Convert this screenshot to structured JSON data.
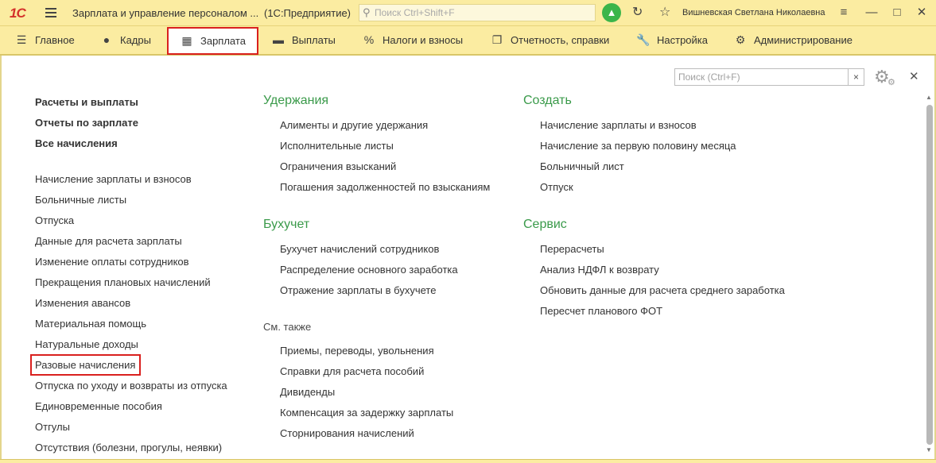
{
  "titlebar": {
    "logo": "1С",
    "app_title": "Зарплата и управление персоналом ...",
    "app_mode": "(1С:Предприятие)",
    "search_placeholder": "Поиск Ctrl+Shift+F",
    "user_name": "Вишневская Светлана Николаевна"
  },
  "sections": [
    {
      "label": "Главное",
      "icon": "menu-icon"
    },
    {
      "label": "Кадры",
      "icon": "people-icon"
    },
    {
      "label": "Зарплата",
      "icon": "calculator-icon",
      "active": true
    },
    {
      "label": "Выплаты",
      "icon": "wallet-icon"
    },
    {
      "label": "Налоги и взносы",
      "icon": "percent-icon"
    },
    {
      "label": "Отчетность, справки",
      "icon": "documents-icon"
    },
    {
      "label": "Настройка",
      "icon": "wrench-icon"
    },
    {
      "label": "Администрирование",
      "icon": "gear-icon"
    }
  ],
  "content": {
    "search_placeholder": "Поиск (Ctrl+F)",
    "left_bold": [
      "Расчеты и выплаты",
      "Отчеты по зарплате",
      "Все начисления"
    ],
    "left_items": [
      "Начисление зарплаты и взносов",
      "Больничные листы",
      "Отпуска",
      "Данные для расчета зарплаты",
      "Изменение оплаты сотрудников",
      "Прекращения плановых начислений",
      "Изменения авансов",
      "Материальная помощь",
      "Натуральные доходы",
      "Разовые начисления",
      "Отпуска по уходу и возвраты из отпуска",
      "Единовременные пособия",
      "Отгулы",
      "Отсутствия (болезни, прогулы, неявки)"
    ],
    "middle": {
      "group1_title": "Удержания",
      "group1_items": [
        "Алименты и другие удержания",
        "Исполнительные листы",
        "Ограничения взысканий",
        "Погашения задолженностей по взысканиям"
      ],
      "group2_title": "Бухучет",
      "group2_items": [
        "Бухучет начислений сотрудников",
        "Распределение основного заработка",
        "Отражение зарплаты в бухучете"
      ],
      "see_also_title": "См. также",
      "see_also_items": [
        "Приемы, переводы, увольнения",
        "Справки для расчета пособий",
        "Дивиденды",
        "Компенсация за задержку зарплаты",
        "Сторнирования начислений"
      ]
    },
    "right": {
      "create_title": "Создать",
      "create_items": [
        "Начисление зарплаты и взносов",
        "Начисление за первую половину месяца",
        "Больничный лист",
        "Отпуск"
      ],
      "service_title": "Сервис",
      "service_items": [
        "Перерасчеты",
        "Анализ НДФЛ к возврату",
        "Обновить данные для расчета среднего заработка",
        "Пересчет планового ФОТ"
      ]
    }
  },
  "colors": {
    "panel_bg": "#fbeca1",
    "group_title": "#3a9a4a",
    "highlight": "#d9201e"
  }
}
